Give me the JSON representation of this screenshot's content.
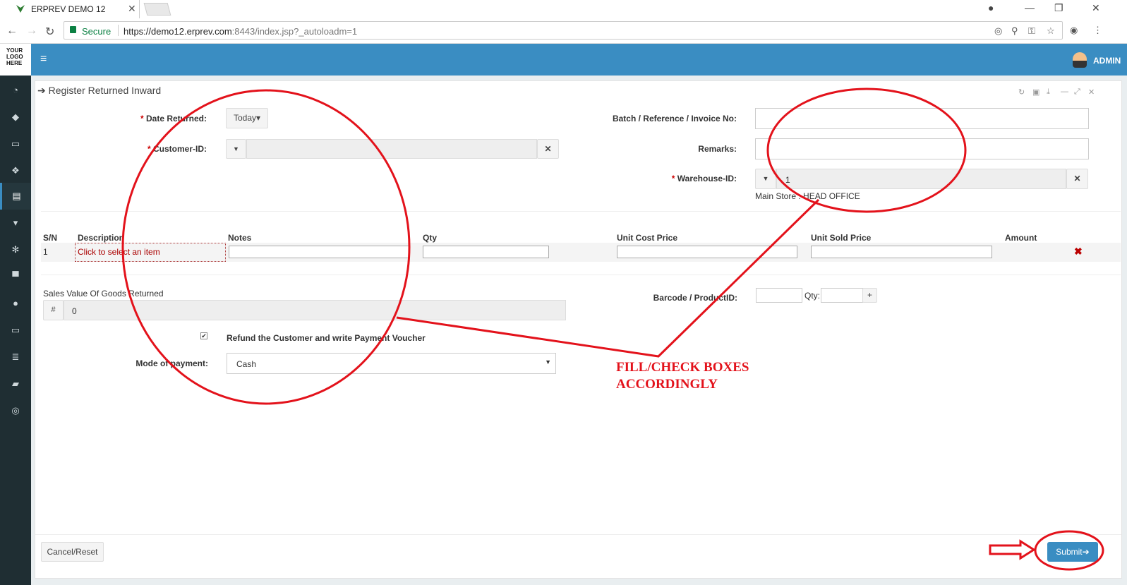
{
  "browser": {
    "tab_title": "ERPREV DEMO 12",
    "secure_label": "Secure",
    "url_host": "https://demo12.erprev.com",
    "url_rest": ":8443/index.jsp?_autoloadm=1"
  },
  "header": {
    "logo_text": "YOUR LOGO HERE",
    "user": "ADMIN"
  },
  "panel": {
    "title": "Register Returned Inward"
  },
  "form": {
    "date_returned_label": "Date Returned:",
    "date_returned_value": "Today",
    "customer_id_label": "Customer-ID:",
    "batch_label": "Batch / Reference / Invoice No:",
    "remarks_label": "Remarks:",
    "warehouse_label": "Warehouse-ID:",
    "warehouse_value": "1",
    "warehouse_desc": "Main Store : HEAD OFFICE"
  },
  "table": {
    "headers": [
      "S/N",
      "Description",
      "Notes",
      "Qty",
      "Unit Cost Price",
      "Unit Sold Price",
      "Amount"
    ],
    "row_sn": "1",
    "row_desc": "Click to select an item"
  },
  "bottom": {
    "sales_value_label": "Sales Value Of Goods Returned",
    "hash": "#",
    "sales_value": "0",
    "barcode_label": "Barcode / ProductID:",
    "qty_label": "Qty:",
    "plus": "+",
    "refund_label": "Refund the Customer and write Payment Voucher",
    "refund_checked": true,
    "mode_label": "Mode of payment:",
    "mode_value": "Cash"
  },
  "footer": {
    "cancel_label": "Cancel/Reset",
    "submit_label": "Submit"
  },
  "annotation": {
    "line1": "FILL/CHECK BOXES",
    "line2": "ACCORDINGLY",
    "color": "#e3121b"
  },
  "colors": {
    "accent": "#3a8dc2",
    "sidebar": "#1f2e33"
  }
}
